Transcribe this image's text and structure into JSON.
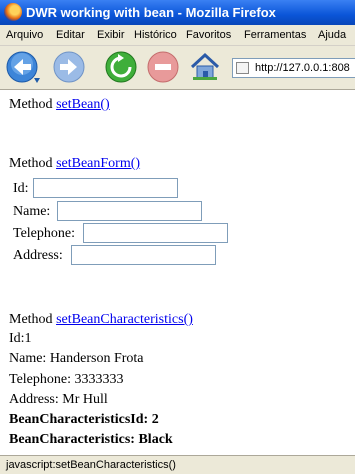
{
  "window": {
    "title": "DWR working with bean - Mozilla Firefox"
  },
  "menu": [
    "Arquivo",
    "Editar",
    "Exibir",
    "Histórico",
    "Favoritos",
    "Ferramentas",
    "Ajuda"
  ],
  "toolbar": {
    "back_icon": "back-arrow-icon",
    "forward_icon": "forward-arrow-icon",
    "reload_icon": "reload-icon",
    "stop_icon": "stop-icon",
    "home_icon": "home-icon",
    "url": "http://127.0.0.1:808"
  },
  "page": {
    "section1": {
      "prefix": "Method",
      "link": "setBean()"
    },
    "section2": {
      "prefix": "Method",
      "link": "setBeanForm()",
      "fields": [
        {
          "label": "Id:",
          "value": ""
        },
        {
          "label": "Name:",
          "value": ""
        },
        {
          "label": "Telephone:",
          "value": ""
        },
        {
          "label": "Address:",
          "value": ""
        }
      ]
    },
    "section3": {
      "prefix": "Method",
      "link": "setBeanCharacteristics()",
      "lines": [
        "Id:1",
        "Name: Handerson Frota",
        "Telephone: 3333333",
        "Address: Mr Hull"
      ],
      "bold_lines": [
        "BeanCharacteristicsId: 2",
        "BeanCharacteristics: Black"
      ]
    }
  },
  "status": {
    "text": "javascript:setBeanCharacteristics()"
  },
  "colors": {
    "title_bar": "#0a55d8",
    "chrome": "#ece9d8",
    "link": "#0000ee"
  }
}
